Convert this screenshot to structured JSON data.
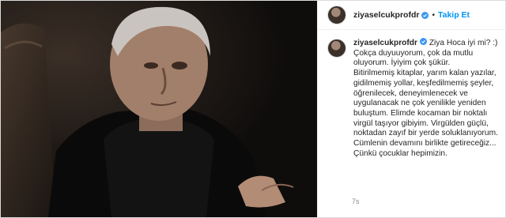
{
  "post": {
    "username": "ziyaselcukprofdr",
    "follow_label": "Takip Et",
    "separator": "•",
    "caption_user": "ziyaselcukprofdr",
    "caption_text": "Ziya Hoca iyi mi? :)\nÇokça duyuuyorum, çok da mutlu oluyorum. İyiyim çok şükür.\nBitirilmemiş kitaplar, yarım kalan yazılar, gidilmemiş yollar, keşfedilmemiş şeyler, öğrenilecek, deneyimlenecek ve uygulanacak ne çok yenilikle yeniden buluştum. Elimde kocaman bir noktalı virgül taşıyor gibiyim. Virgülden güçlü, noktadan zayıf bir yerde soluklanıyorum. Cümlenin devamını birlikte getireceğiz... Çünkü çocuklar hepimizin.",
    "time": "7s"
  },
  "colors": {
    "accent": "#0095f6",
    "verified": "#3897f0",
    "text": "#262626",
    "muted": "#8e8e8e"
  },
  "icons": [
    "verified-badge-icon"
  ]
}
